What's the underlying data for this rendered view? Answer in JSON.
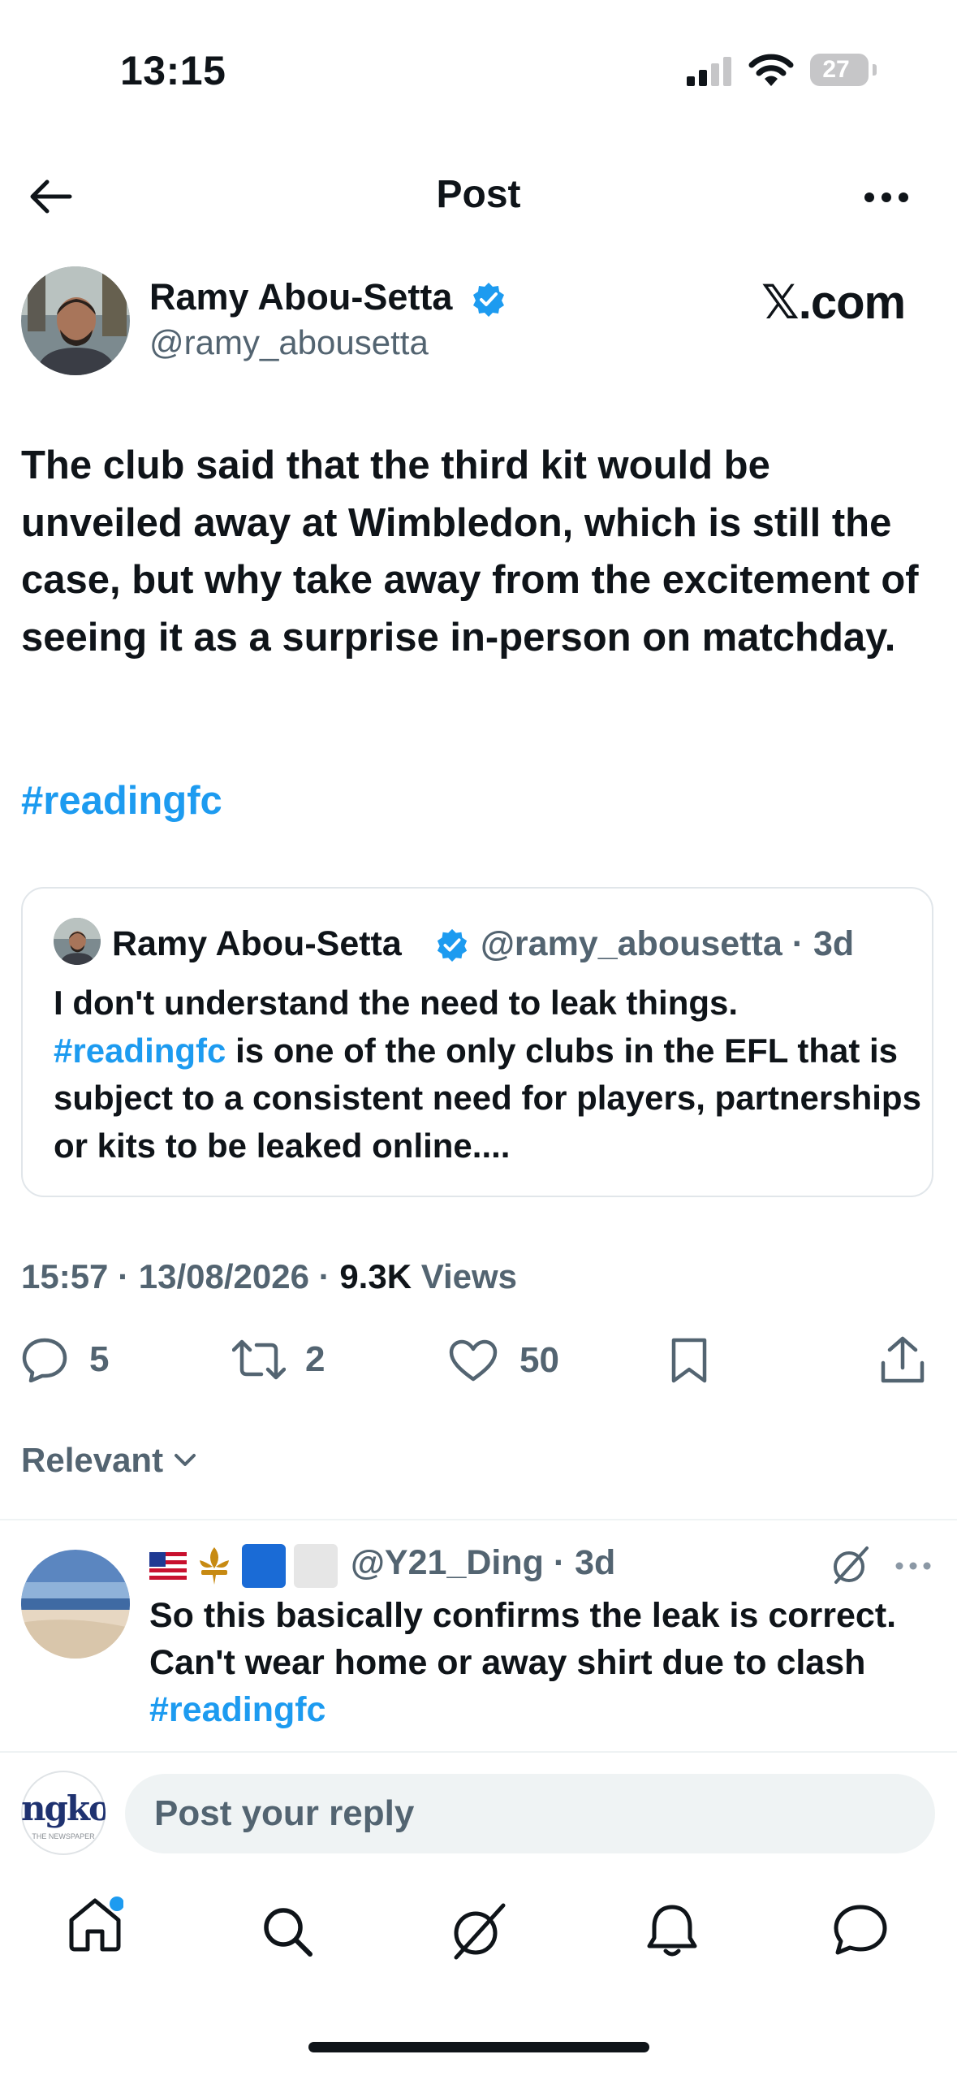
{
  "status_bar": {
    "time": "13:15",
    "battery": "27"
  },
  "header": {
    "title": "Post"
  },
  "post": {
    "author_name": "Ramy Abou-Setta",
    "author_handle": "@ramy_abousetta",
    "source_label": "𝕏.com",
    "text": "The club said that the third kit would be unveiled away at Wimbledon, which is still the case, but why take away from the excitement of seeing it as a surprise in-person on matchday.",
    "hashtag": "#readingfc",
    "quote": {
      "author_name": "Ramy Abou-Setta",
      "author_handle": "@ramy_abousetta",
      "separator": "·",
      "time": "3d",
      "line1": "I don't understand the need to leak things.",
      "hashtag": "#readingfc",
      "line2_rest": " is one of the only clubs in the EFL that is subject to a consistent need for players, partnerships or kits to be leaked online...."
    },
    "meta": {
      "time": "15:57",
      "date": "13/08/2026",
      "views_count": "9.3K",
      "views_label": "Views",
      "separator": "·"
    },
    "actions": {
      "replies": "5",
      "reposts": "2",
      "likes": "50"
    }
  },
  "sort": {
    "label": "Relevant"
  },
  "reply": {
    "handle": "@Y21_Ding",
    "separator": "·",
    "time": "3d",
    "text": "So this basically confirms the leak is correct. Can't wear home or away shirt due to clash",
    "hashtag": "#readingfc"
  },
  "composer": {
    "placeholder": "Post your reply",
    "avatar_text": "ngko",
    "avatar_subtext": "THE NEWSPAPER"
  },
  "colors": {
    "accent": "#1d9bf0",
    "muted": "#536471",
    "text": "#0f1419",
    "verified": "#1d9bf0"
  },
  "icons": {
    "status": [
      "signal-icon",
      "wifi-icon",
      "battery-icon"
    ],
    "header": [
      "back-arrow-icon",
      "more-icon"
    ],
    "actions": [
      "reply-icon",
      "repost-icon",
      "like-icon",
      "bookmark-icon",
      "share-icon"
    ],
    "nav": [
      "home-icon",
      "search-icon",
      "grok-icon",
      "notifications-icon",
      "messages-icon"
    ]
  }
}
